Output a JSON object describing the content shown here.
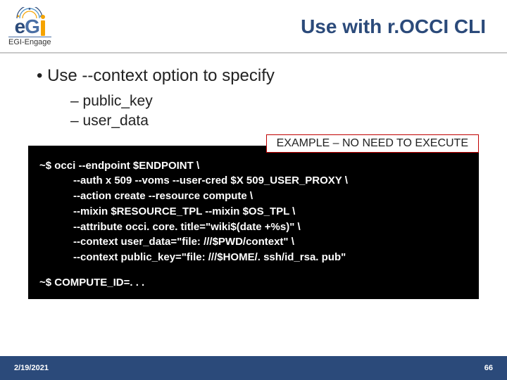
{
  "logo": {
    "name": "eGI",
    "sub": "EGI-Engage"
  },
  "title": "Use with r.OCCI CLI",
  "bullet_main": "• Use --context option to specify",
  "sub_bullets": [
    "– public_key",
    "– user_data"
  ],
  "example_tag": "EXAMPLE – NO NEED TO EXECUTE",
  "terminal": {
    "line1": "~$ occi --endpoint $ENDPOINT \\",
    "line2": "--auth x 509 --voms --user-cred $X 509_USER_PROXY \\",
    "line3": "--action create --resource compute \\",
    "line4": "--mixin $RESOURCE_TPL --mixin $OS_TPL \\",
    "line5": "--attribute occi. core. title=\"wiki$(date +%s)\" \\",
    "line6": "--context user_data=\"file: ///$PWD/context\" \\",
    "line7": "--context public_key=\"file: ///$HOME/. ssh/id_rsa. pub\"",
    "line8": "~$ COMPUTE_ID=. . ."
  },
  "footer": {
    "date": "2/19/2021",
    "page": "66"
  }
}
